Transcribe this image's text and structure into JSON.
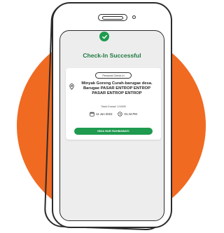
{
  "colors": {
    "accent_orange": "#F06A22",
    "brand_green": "#1F9A4F",
    "title_green": "#1F7A42"
  },
  "icons": {
    "success": "check-circle-icon",
    "location": "map-pin-icon",
    "date": "calendar-icon",
    "time": "clock-icon"
  },
  "checkin": {
    "title": "Check-In Successful",
    "type_label": "Personal Check-In",
    "venue_line1": "Minyak Goreng Curah-barugae desa.",
    "venue_line2": "Barugae PASAR ENTROP ENTROP",
    "venue_line3": "PASAR ENTROP ENTROP",
    "crowd_text": "Total Crowd: 1/1000",
    "date": "11 Jun 2022",
    "time": "01:44 PM",
    "name_button": "INDA NUR RAHMAWATI"
  }
}
